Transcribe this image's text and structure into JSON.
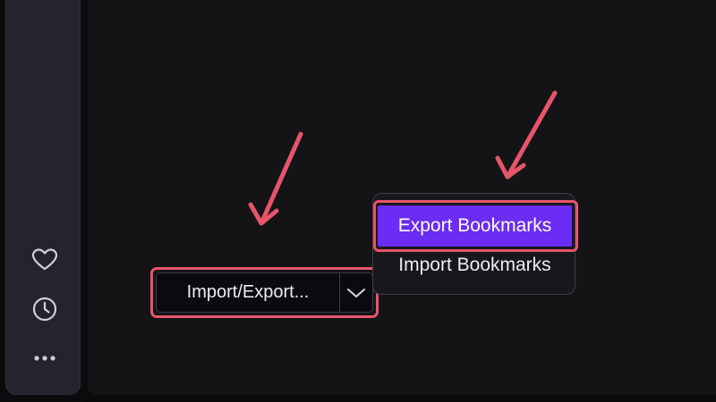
{
  "sidebar": {
    "icons": [
      "heart-icon",
      "clock-icon",
      "more-dots-icon"
    ]
  },
  "split_button": {
    "label": "Import/Export...",
    "caret_icon": "chevron-down-icon"
  },
  "dropdown": {
    "items": [
      {
        "label": "Export Bookmarks",
        "selected": true
      },
      {
        "label": "Import Bookmarks",
        "selected": false
      }
    ]
  },
  "colors": {
    "highlight": "#e8546a",
    "selected": "#6b2cf5",
    "sidebar": "#23242e",
    "background": "#141416"
  }
}
